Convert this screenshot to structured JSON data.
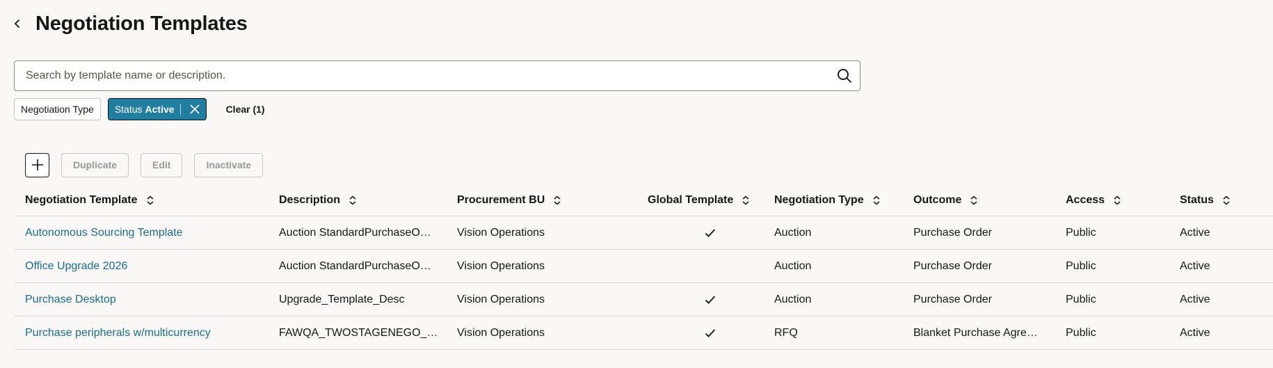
{
  "header": {
    "title": "Negotiation Templates"
  },
  "search": {
    "placeholder": "Search by template name or description."
  },
  "filters": {
    "type_chip": "Negotiation Type",
    "status_key": "Status",
    "status_value": "Active",
    "clear_label": "Clear (1)"
  },
  "toolbar": {
    "duplicate_label": "Duplicate",
    "edit_label": "Edit",
    "inactivate_label": "Inactivate"
  },
  "table": {
    "columns": [
      "Negotiation Template",
      "Description",
      "Procurement BU",
      "Global Template",
      "Negotiation Type",
      "Outcome",
      "Access",
      "Status"
    ],
    "rows": [
      {
        "template": "Autonomous Sourcing Template",
        "description": "Auction StandardPurchaseO…",
        "bu": "Vision Operations",
        "global": true,
        "type": "Auction",
        "outcome": "Purchase Order",
        "access": "Public",
        "status": "Active"
      },
      {
        "template": "Office Upgrade 2026",
        "description": "Auction StandardPurchaseO…",
        "bu": "Vision Operations",
        "global": false,
        "type": "Auction",
        "outcome": "Purchase Order",
        "access": "Public",
        "status": "Active"
      },
      {
        "template": "Purchase Desktop",
        "description": "Upgrade_Template_Desc",
        "bu": "Vision Operations",
        "global": true,
        "type": "Auction",
        "outcome": "Purchase Order",
        "access": "Public",
        "status": "Active"
      },
      {
        "template": "Purchase peripherals w/multicurrency",
        "description": "FAWQA_TWOSTAGENEGO_…",
        "bu": "Vision Operations",
        "global": true,
        "type": "RFQ",
        "outcome": "Blanket Purchase Agre…",
        "access": "Public",
        "status": "Active"
      }
    ]
  },
  "colors": {
    "accent": "#227e9e",
    "link": "#1b6b8c",
    "background": "#f9f8f6"
  }
}
